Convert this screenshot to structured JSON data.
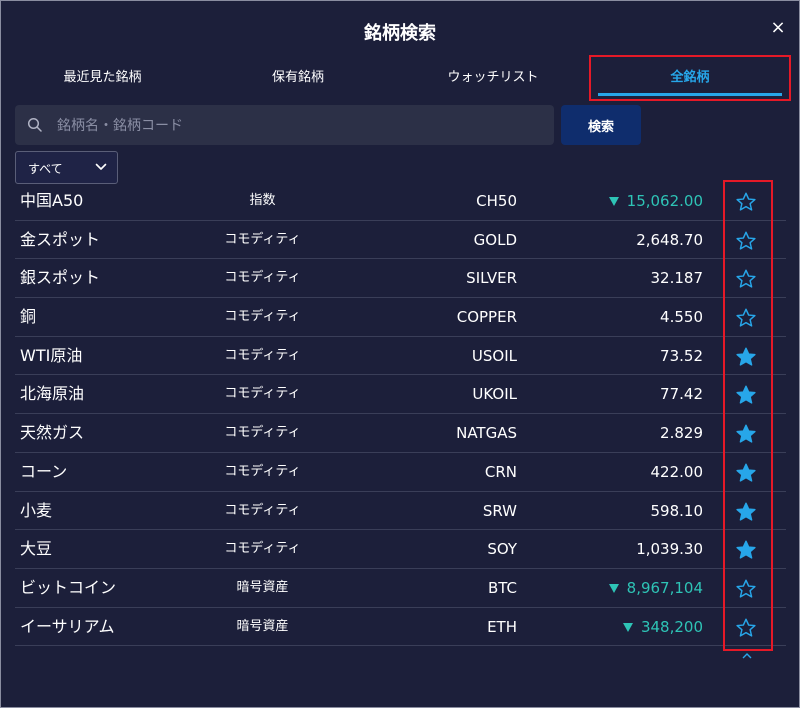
{
  "dialog": {
    "title": "銘柄検索",
    "close_icon": "×"
  },
  "tabs": [
    {
      "label": "最近見た銘柄",
      "active": false
    },
    {
      "label": "保有銘柄",
      "active": false
    },
    {
      "label": "ウォッチリスト",
      "active": false
    },
    {
      "label": "全銘柄",
      "active": true
    }
  ],
  "search": {
    "placeholder": "銘柄名・銘柄コード",
    "value": "",
    "button_label": "検索"
  },
  "filter": {
    "selected": "すべて"
  },
  "colors": {
    "accent": "#27a6e9",
    "down": "#2ec4b6",
    "highlight": "#e51927",
    "background": "#1c1f3a"
  },
  "instruments": [
    {
      "name": "中国A50",
      "category": "指数",
      "code": "CH50",
      "price": "15,062.00",
      "trend": "down",
      "favorite": false
    },
    {
      "name": "金スポット",
      "category": "コモディティ",
      "code": "GOLD",
      "price": "2,648.70",
      "trend": "none",
      "favorite": false
    },
    {
      "name": "銀スポット",
      "category": "コモディティ",
      "code": "SILVER",
      "price": "32.187",
      "trend": "none",
      "favorite": false
    },
    {
      "name": "銅",
      "category": "コモディティ",
      "code": "COPPER",
      "price": "4.550",
      "trend": "none",
      "favorite": false
    },
    {
      "name": "WTI原油",
      "category": "コモディティ",
      "code": "USOIL",
      "price": "73.52",
      "trend": "none",
      "favorite": true
    },
    {
      "name": "北海原油",
      "category": "コモディティ",
      "code": "UKOIL",
      "price": "77.42",
      "trend": "none",
      "favorite": true
    },
    {
      "name": "天然ガス",
      "category": "コモディティ",
      "code": "NATGAS",
      "price": "2.829",
      "trend": "none",
      "favorite": true
    },
    {
      "name": "コーン",
      "category": "コモディティ",
      "code": "CRN",
      "price": "422.00",
      "trend": "none",
      "favorite": true
    },
    {
      "name": "小麦",
      "category": "コモディティ",
      "code": "SRW",
      "price": "598.10",
      "trend": "none",
      "favorite": true
    },
    {
      "name": "大豆",
      "category": "コモディティ",
      "code": "SOY",
      "price": "1,039.30",
      "trend": "none",
      "favorite": true
    },
    {
      "name": "ビットコイン",
      "category": "暗号資産",
      "code": "BTC",
      "price": "8,967,104",
      "trend": "down",
      "favorite": false
    },
    {
      "name": "イーサリアム",
      "category": "暗号資産",
      "code": "ETH",
      "price": "348,200",
      "trend": "down",
      "favorite": false
    }
  ]
}
